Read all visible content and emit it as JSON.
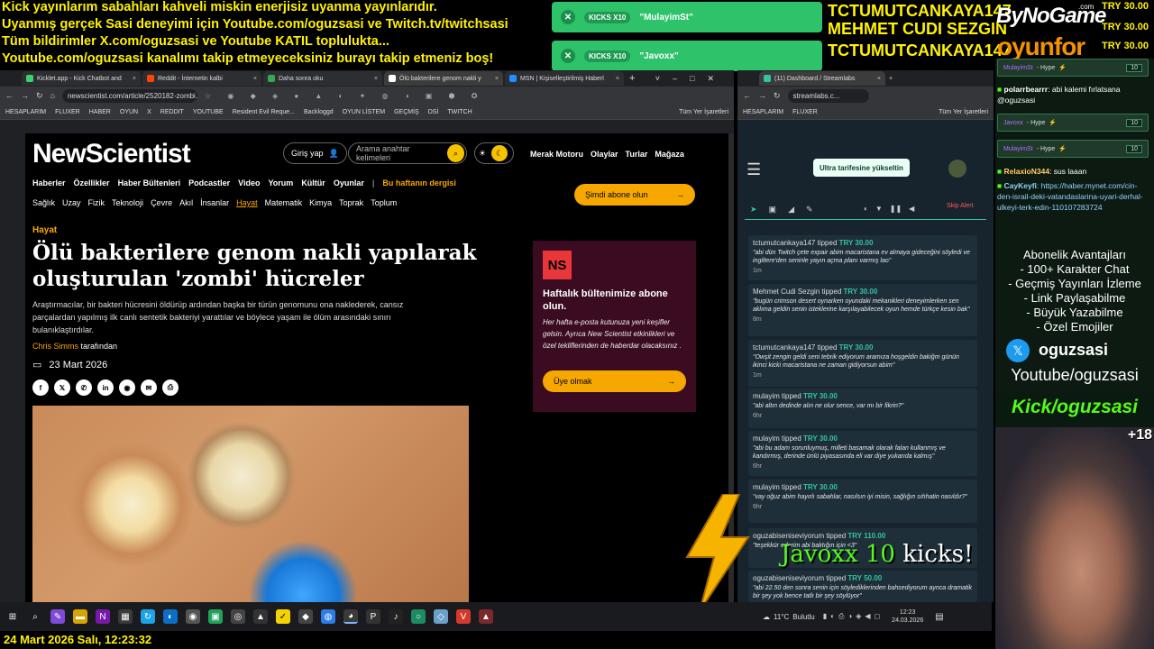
{
  "ticker": [
    "Kick yayınlarım sabahları kahveli miskin enerjisiz uyanma yayınlarıdır.",
    "Uyanmış gerçek Sasi deneyimi için Youtube.com/oguzsasi ve Twitch.tv/twitchsasi",
    "Tüm bildirimler X.com/oguzsasi ve Youtube KATIL toplulukta...",
    "Youtube.com/oguzsasi kanalımı takip etmeyeceksiniz burayı takip etmeniz boş!"
  ],
  "kick_alerts": [
    {
      "amount": "KICKS X10",
      "name": "\"MulayimSt\""
    },
    {
      "amount": "KICKS X10",
      "name": "\"Javoxx\""
    }
  ],
  "top_tippers": [
    {
      "name": "TCTUMUTCANKAYA147",
      "amount": "TRY 30.00"
    },
    {
      "name": "MEHMET CUDI SEZGIN",
      "amount": "TRY 30.00"
    },
    {
      "name": "TCTUMUTCANKAYA147",
      "amount": "TRY 30.00"
    }
  ],
  "brand": {
    "byno": "ByNoGame",
    "oyunfor": "oyunfor",
    "com": ".com"
  },
  "browser": {
    "tabs": [
      "Kicklet.app - Kick Chatbot and",
      "Reddit - İnternetin kalbi",
      "Daha sonra oku",
      "Ölü bakterilere genom nakli y",
      "MSN | Kişiselleştirilmiş Haberl"
    ],
    "url": "newscientist.com/article/2520182-zombi...",
    "bookmarks": [
      "HESAPLARIM",
      "FLUXER",
      "HABER",
      "OYUN",
      "X",
      "REDDIT",
      "YOUTUBE",
      "Resident Evil Reque...",
      "Backloggd",
      "OYUN LİSTEM",
      "GEÇMİŞ",
      "DSİ",
      "TWITCH",
      "Tüm Yer İşaretleri"
    ]
  },
  "site": {
    "logo": "NewScientist",
    "login": "Giriş yap",
    "search_placeholder": "Arama anahtar kelimeleri",
    "top_links": [
      "Merak Motoru",
      "Olaylar",
      "Turlar",
      "Mağaza"
    ],
    "nav1": [
      "Haberler",
      "Özellikler",
      "Haber Bültenleri",
      "Podcastler",
      "Video",
      "Yorum",
      "Kültür",
      "Oyunlar"
    ],
    "nav1_highlight": "Bu haftanın dergisi",
    "nav2": [
      "Sağlık",
      "Uzay",
      "Fizik",
      "Teknoloji",
      "Çevre",
      "Akıl",
      "İnsanlar",
      "Hayat",
      "Matematik",
      "Kimya",
      "Toprak",
      "Toplum"
    ],
    "subscribe": "Şimdi abone olun",
    "category": "Hayat",
    "headline": "Ölü bakterilere genom nakli yapılarak oluşturulan 'zombi' hücreler",
    "summary": "Araştırmacılar, bir bakteri hücresini öldürüp ardından başka bir türün genomunu ona naklederek, cansız parçalardan yapılmış ilk canlı sentetik bakteriyi yarattılar ve böylece yaşam ile ölüm arasındaki sınırı bulanıklaştırdılar.",
    "author": "Chris Simms",
    "author_suffix": "tarafından",
    "date": "23 Mart 2026",
    "newsletter": {
      "badge": "NS",
      "title": "Haftalık bültenimize abone olun.",
      "text": "Her hafta e-posta kutunuza yeni keşifler gelsin. Ayrıca New Scientist etkinlikleri ve özel tekliflerinden de haberdar olacaksınız .",
      "button": "Üye olmak"
    }
  },
  "streamlabs": {
    "tab": "(11) Dashboard / Streamlabs",
    "url": "streamlabs.c...",
    "bookmarks": [
      "HESAPLARIM",
      "FLUXER",
      "Tüm Yer İşaretleri"
    ],
    "upgrade": "Ultra tarifesine yükseltin",
    "skip": "Skip Alert",
    "tipped_word": "tipped",
    "tips": [
      {
        "user": "tctumutcankaya147",
        "amount": "TRY 30.00",
        "msg": "\"abi dün Twitch çete expair abim macaristana ev almaya gideceğini söyledi ve ingiltere'den seninle yayın açma planı varmış lao\"",
        "time": "1m"
      },
      {
        "user": "Mehmet Cudi Sezgin",
        "amount": "TRY 30.00",
        "msg": "\"bugün crimson desert oynarken oyundaki mekanikleri deneyimlerken sen aklıma geldin senin isteklerine karşılayabilecek oyun hemde türkçe kesin bak\"",
        "time": "8m"
      },
      {
        "user": "tctumutcankaya147",
        "amount": "TRY 30.00",
        "msg": "\"Owşit zengin geldi seni tebrik ediyorum aramıza hoşgeldin bakiğm günün ikinci kicki macaristana ne zaman gidiyorsun abim\"",
        "time": "1m"
      },
      {
        "user": "mulayim",
        "amount": "TRY 30.00",
        "msg": "\"abi altın dedinde alın ne olur sence, var mı bir fikrin?\"",
        "time": "6hr"
      },
      {
        "user": "mulayim",
        "amount": "TRY 30.00",
        "msg": "\"abi bu adam sorunluymuş, milleti basamak olarak falan kullanmış ve kandırmış, derinde ünlü piyasasında eli var diye yukarıda kalmış\"",
        "time": "6hr"
      },
      {
        "user": "mulayim",
        "amount": "TRY 30.00",
        "msg": "\"vay oğuz abim hayırlı sabahlar, nasılsın iyi misin, sağlığın sıhhatin nasıldır?\"",
        "time": "6hr"
      },
      {
        "user": "oguzabiseniseviyorum",
        "amount": "TRY 110.00",
        "msg": "\"teşekkür ederim abi baktığın için <3\"",
        "time": ""
      },
      {
        "user": "oguzabiseniseviyorum",
        "amount": "TRY 50.00",
        "msg": "\"abi 22.50 den sonra senin için söylediklerinden bahsediyorum aynca dramatik bir şey yok bence tatlı bir şey söylüyor\"",
        "time": ""
      }
    ]
  },
  "overlay_kicks": {
    "user": "Javoxx",
    "amount": "10",
    "word": "kicks!"
  },
  "chat": {
    "hype": [
      {
        "name": "MulayimSt",
        "label": "- Hype",
        "count": "10"
      },
      {
        "name": "Javoxx",
        "label": "- Hype",
        "count": "10"
      },
      {
        "name": "MulayimSt",
        "label": "- Hype",
        "count": "10"
      }
    ],
    "lines": [
      {
        "user": "polarrbearrr",
        "text": ": abi kalemi fırlatsana @oguzsasi"
      },
      {
        "user": "RelaxioN344",
        "text": ": sus laaan"
      },
      {
        "user": "CayKeyfi",
        "text": ": https://haber.mynet.com/cin-den-israil-deki-vatandaslarina-uyari-derhal-ulkeyi-terk-edin-110107283724"
      }
    ]
  },
  "perks": {
    "title": "Abonelik Avantajları",
    "items": [
      "- 100+ Karakter Chat",
      "- Geçmiş Yayınları İzleme",
      "- Link Paylaşabilme",
      "- Büyük Yazabilme",
      "- Özel Emojiler"
    ],
    "x_handle": "oguzsasi",
    "youtube": "Youtube/oguzsasi",
    "kick": "Kick/oguzsasi",
    "age": "+18"
  },
  "taskbar": {
    "weather": "11°C",
    "weather_text": "Bulutlu",
    "time": "12:23",
    "date": "24.03.2026"
  },
  "footer_clock": "24 Mart 2026 Salı, 12:23:32"
}
